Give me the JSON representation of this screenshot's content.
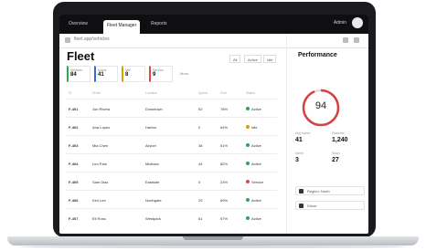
{
  "browser": {
    "tabs": [
      "Overview",
      "Fleet Manager",
      "Reports"
    ],
    "active_tab": 1,
    "right_text": "Admin",
    "address": "fleet.app/vehicles"
  },
  "page": {
    "title": "Fleet",
    "filters": [
      "All",
      "Active",
      "Idle"
    ],
    "more_label": "More"
  },
  "cards": [
    {
      "label": "Vehicles",
      "value": "84",
      "color": "#2fa84f"
    },
    {
      "label": "Active",
      "value": "41",
      "color": "#2f6fd8"
    },
    {
      "label": "Idle",
      "value": "8",
      "color": "#e0a100"
    },
    {
      "label": "Service",
      "value": "9",
      "color": "#e04848"
    }
  ],
  "table": {
    "headers": [
      "ID",
      "Driver",
      "Location",
      "Speed",
      "Fuel",
      "Status"
    ],
    "rows": [
      {
        "id": "F-401",
        "driver": "Jon Rivera",
        "loc": "Downtown",
        "speed": "52",
        "fuel": "78%",
        "status": "Active",
        "color": "#2fa84f"
      },
      {
        "id": "F-402",
        "driver": "Ana Lopez",
        "loc": "Harbor",
        "speed": "0",
        "fuel": "64%",
        "status": "Idle",
        "color": "#e0a100"
      },
      {
        "id": "F-403",
        "driver": "Mia Chen",
        "loc": "Airport",
        "speed": "38",
        "fuel": "51%",
        "status": "Active",
        "color": "#2fa84f"
      },
      {
        "id": "F-404",
        "driver": "Leo Park",
        "loc": "Midtown",
        "speed": "44",
        "fuel": "82%",
        "status": "Active",
        "color": "#2fa84f"
      },
      {
        "id": "F-405",
        "driver": "Sam Diaz",
        "loc": "Eastside",
        "speed": "0",
        "fuel": "23%",
        "status": "Service",
        "color": "#e04848"
      },
      {
        "id": "F-406",
        "driver": "Kim Lee",
        "loc": "Northgate",
        "speed": "29",
        "fuel": "69%",
        "status": "Active",
        "color": "#2fa84f"
      },
      {
        "id": "F-407",
        "driver": "Eli Ross",
        "loc": "Westpark",
        "speed": "61",
        "fuel": "57%",
        "status": "Active",
        "color": "#2fa84f"
      }
    ]
  },
  "panel": {
    "title": "Performance",
    "gauge_value": "94",
    "gauge_fraction": 0.94,
    "stats": [
      {
        "label": "Avg speed",
        "value": "41"
      },
      {
        "label": "Distance",
        "value": "1,240"
      },
      {
        "label": "Alerts",
        "value": "3"
      },
      {
        "label": "Stops",
        "value": "27"
      }
    ],
    "select_1": "Region: North",
    "select_2": "Driver"
  }
}
